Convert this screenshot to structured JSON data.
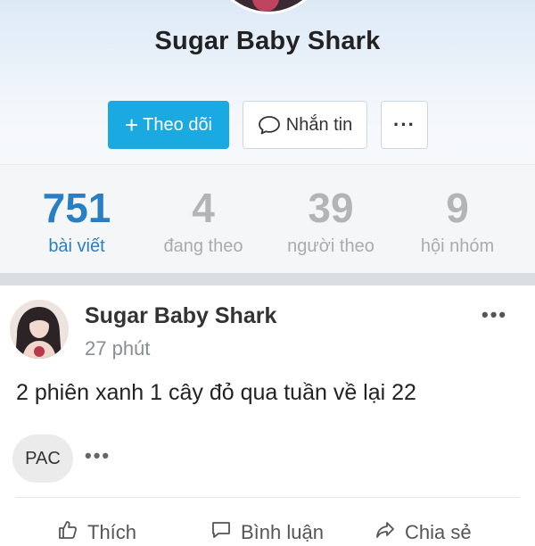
{
  "profile": {
    "name": "Sugar Baby Shark",
    "follow_button": {
      "icon": "plus-icon",
      "label": "Theo dõi"
    },
    "message_button": {
      "icon": "chat-bubble-icon",
      "label": "Nhắn tin"
    },
    "more_button": {
      "icon": "more-horizontal-icon",
      "label": "···"
    }
  },
  "stats": [
    {
      "value": "751",
      "label": "bài viết",
      "active": true
    },
    {
      "value": "4",
      "label": "đang theo",
      "active": false
    },
    {
      "value": "39",
      "label": "người theo",
      "active": false
    },
    {
      "value": "9",
      "label": "hội nhóm",
      "active": false
    }
  ],
  "post": {
    "author": "Sugar Baby Shark",
    "time": "27 phút",
    "menu": "•••",
    "text": "2 phiên xanh 1 cây đỏ qua tuần về lại 22",
    "tag": "PAC",
    "tag_more": "•••",
    "actions": [
      {
        "icon": "like-icon",
        "label": "Thích"
      },
      {
        "icon": "comment-icon",
        "label": "Bình luận"
      },
      {
        "icon": "share-icon",
        "label": "Chia sẻ"
      }
    ]
  },
  "colors": {
    "accent": "#1ba9e1",
    "active_stat": "#2a7fc4",
    "inactive_stat": "#b2b5b8"
  }
}
